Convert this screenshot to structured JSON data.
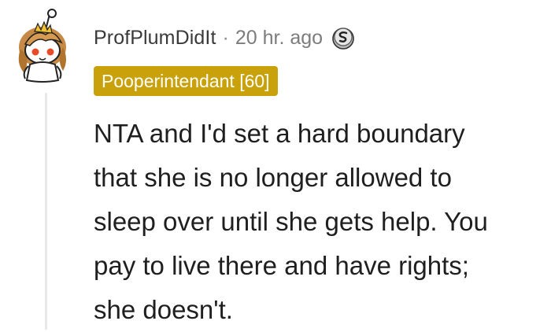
{
  "comment": {
    "author": "ProfPlumDidIt",
    "separator": "·",
    "timestamp": "20 hr. ago",
    "flair": "Pooperintendant [60]",
    "body_lines": [
      "NTA and I'd set a hard boundary",
      "that she is no longer allowed to",
      "sleep over until she gets help. You",
      "pay to live there and have rights;",
      "she doesn't."
    ]
  },
  "colors": {
    "flair_background": "#c9a10a",
    "thread_line": "#e8e8e8"
  },
  "icons": {
    "avatar": "snoo-avatar",
    "award": "silver-award-icon"
  }
}
